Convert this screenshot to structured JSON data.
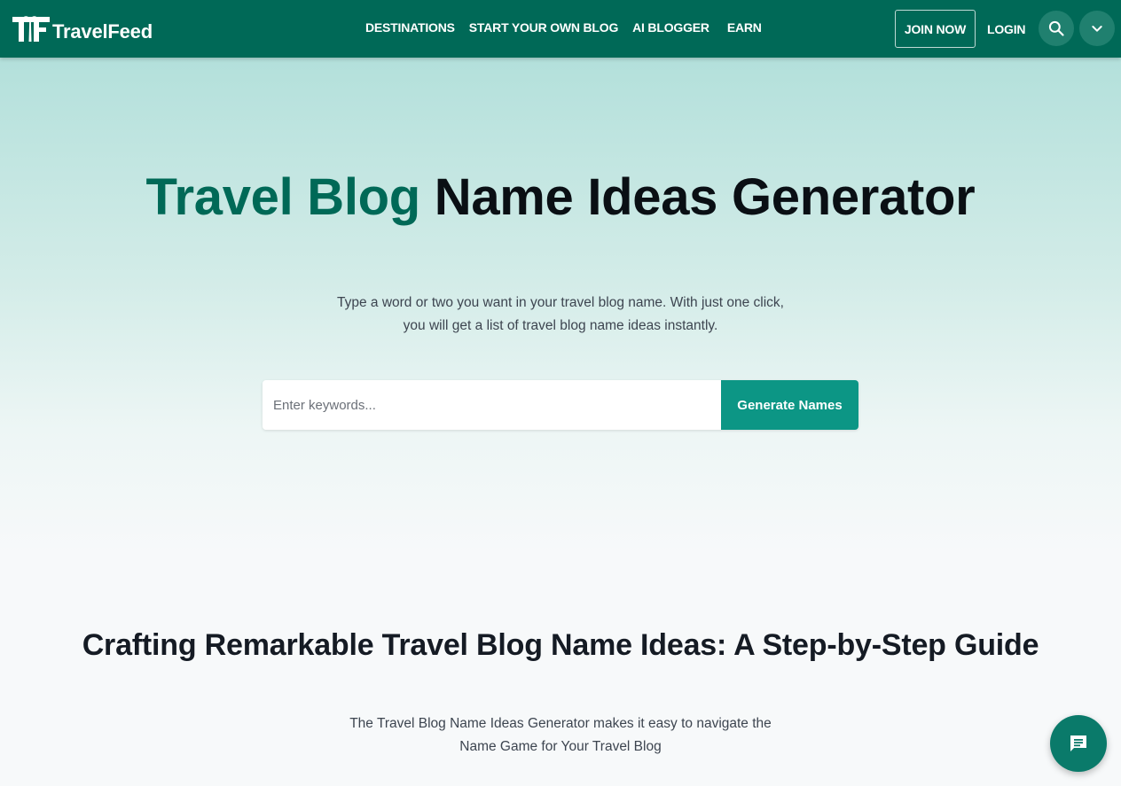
{
  "navbar": {
    "brand": "TravelFeed",
    "links": [
      {
        "label": "DESTINATIONS"
      },
      {
        "label": "START YOUR OWN BLOG"
      },
      {
        "label": "AI BLOGGER"
      },
      {
        "label": "EARN"
      }
    ],
    "join_label": "JOIN NOW",
    "login_label": "LOGIN",
    "search_icon": "search-icon",
    "menu_icon": "chevron-down-icon"
  },
  "hero": {
    "title_accent": "Travel Blog",
    "title_rest": "Name Ideas Generator",
    "subtitle": "Type a word or two you want in your travel blog name. With just one click, you will get a list of travel blog name ideas instantly.",
    "input_placeholder": "Enter keywords...",
    "input_value": "",
    "button_label": "Generate Names"
  },
  "guide": {
    "title": "Crafting Remarkable Travel Blog Name Ideas: A Step-by-Step Guide",
    "subtitle": "The Travel Blog Name Ideas Generator makes it easy to navigate the Name Game for Your Travel Blog"
  },
  "chat": {
    "icon": "chat-icon"
  },
  "colors": {
    "brand": "#006957",
    "button": "#0c9685",
    "accent_text": "#006957"
  }
}
